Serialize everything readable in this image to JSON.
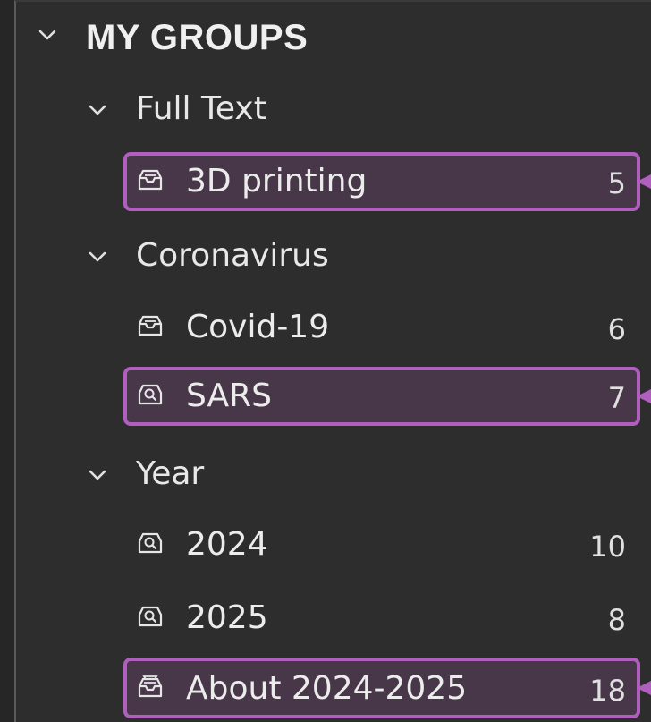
{
  "tree": {
    "root": {
      "label": "MY GROUPS"
    },
    "groups": [
      {
        "label": "Full Text",
        "items": [
          {
            "label": "3D printing",
            "count": "5",
            "icon": "inbox-icon",
            "highlighted": true
          }
        ]
      },
      {
        "label": "Coronavirus",
        "items": [
          {
            "label": "Covid-19",
            "count": "6",
            "icon": "inbox-icon",
            "highlighted": false
          },
          {
            "label": "SARS",
            "count": "7",
            "icon": "search-box-icon",
            "highlighted": true
          }
        ]
      },
      {
        "label": "Year",
        "items": [
          {
            "label": "2024",
            "count": "10",
            "icon": "search-box-icon",
            "highlighted": false
          },
          {
            "label": "2025",
            "count": "8",
            "icon": "search-box-icon",
            "highlighted": false
          },
          {
            "label": "About 2024-2025",
            "count": "18",
            "icon": "inbox-stack-icon",
            "highlighted": true
          }
        ]
      }
    ]
  },
  "colors": {
    "background": "#2d2d2d",
    "text": "#e6e6e6",
    "highlight_border": "#b15fbe",
    "highlight_fill": "#4a3a4a"
  }
}
